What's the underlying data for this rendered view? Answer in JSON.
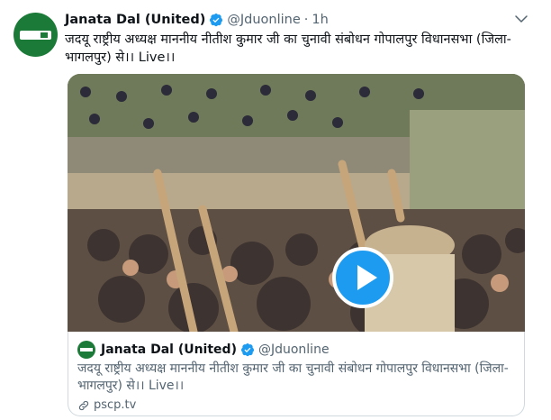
{
  "tweet": {
    "author_name": "Janata Dal (United)",
    "handle": "@Jduonline",
    "separator": "·",
    "time": "1h",
    "text": "जदयू राष्ट्रीय अध्यक्ष माननीय नीतीश कुमार जी का चुनावी संबोधन  गोपालपुर विधानसभा (जिला- भागलपुर) से।। Live।।"
  },
  "card": {
    "author_name": "Janata Dal (United)",
    "handle": "@Jduonline",
    "text": "जदयू राष्ट्रीय अध्यक्ष माननीय नीतीश कुमार जी का चुनावी संबोधन गोपालपुर विधानसभा (जिला- भागलपुर) से।। Live।।",
    "link": "pscp.tv"
  },
  "icons": {
    "verified": "verified-badge-icon",
    "more": "chevron-down-icon",
    "play": "play-icon",
    "link": "link-icon"
  },
  "colors": {
    "accent": "#1d9bf0",
    "brand_green": "#1b7a37",
    "muted_text": "#536471"
  }
}
